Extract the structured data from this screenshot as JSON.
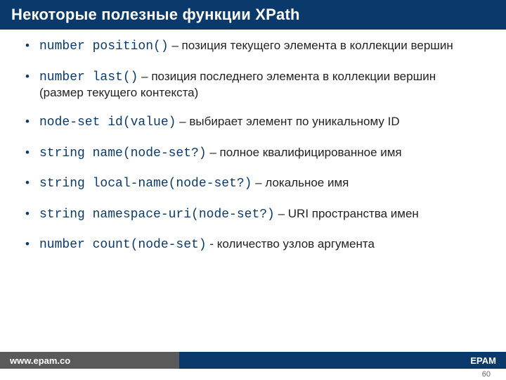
{
  "title": "Некоторые полезные функции XPath",
  "items": [
    {
      "code": "number position()",
      "sep": " – ",
      "desc": "позиция текущего элемента в коллекции вершин"
    },
    {
      "code": "number last()",
      "sep": " – ",
      "desc": "позиция последнего элемента в коллекции вершин (размер текущего контекста)"
    },
    {
      "code": "node-set id(value)",
      "sep": " – ",
      "desc": "выбирает элемент по уникальному ID"
    },
    {
      "code": "string name(node-set?)",
      "sep": " – ",
      "desc": "полное квалифицированное имя"
    },
    {
      "code": "string local-name(node-set?)",
      "sep": " – ",
      "desc": "локальное имя"
    },
    {
      "code": "string namespace-uri(node-set?)",
      "sep": " – ",
      "desc": "URI пространства имен"
    },
    {
      "code": "number count(node-set)",
      "sep": " - ",
      "desc": "количество узлов аргумента"
    }
  ],
  "footer": {
    "left": "www.epam.co",
    "right": "EPAM"
  },
  "page_number": "60"
}
